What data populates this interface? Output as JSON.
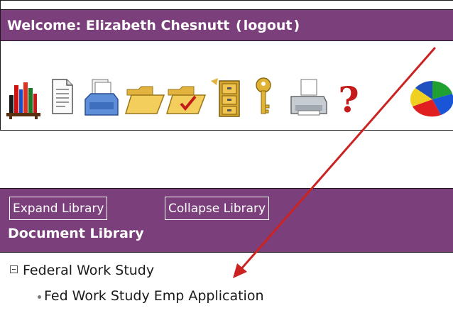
{
  "header": {
    "welcome_prefix": "Welcome: Elizabeth Chesnutt",
    "paren_open": "(",
    "logout_label": "logout",
    "paren_close": ")"
  },
  "toolbar": {
    "icons": [
      "bookshelf-icon",
      "document-icon",
      "inbox-tray-icon",
      "open-folder-icon",
      "folder-check-icon",
      "filing-cabinet-icon",
      "key-icon",
      "printer-icon",
      "help-icon",
      "pie-chart-icon"
    ]
  },
  "library": {
    "expand_label": "Expand Library",
    "collapse_label": "Collapse Library",
    "title": "Document Library"
  },
  "tree": {
    "folder_label": "Federal Work Study",
    "document_label": "Fed Work Study Emp Application"
  },
  "colors": {
    "header_purple": "#7b3f7c",
    "annotation_arrow": "#cc2222"
  }
}
